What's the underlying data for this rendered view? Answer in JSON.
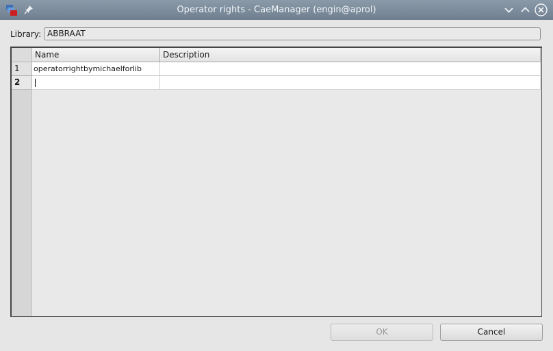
{
  "window": {
    "title": "Operator rights - CaeManager (engin@aprol)"
  },
  "icons": {
    "app": "app-icon",
    "pin": "pin-icon",
    "minimize": "chevron-down-icon",
    "maximize": "chevron-up-icon",
    "close": "close-icon"
  },
  "library": {
    "label": "Library:",
    "value": "ABBRAAT"
  },
  "table": {
    "columns": [
      "Name",
      "Description"
    ],
    "rows": [
      {
        "num": "1",
        "name": "operatorrightbymichaelforlib",
        "description": ""
      },
      {
        "num": "2",
        "name": "",
        "description": ""
      }
    ]
  },
  "buttons": {
    "ok": "OK",
    "cancel": "Cancel"
  }
}
